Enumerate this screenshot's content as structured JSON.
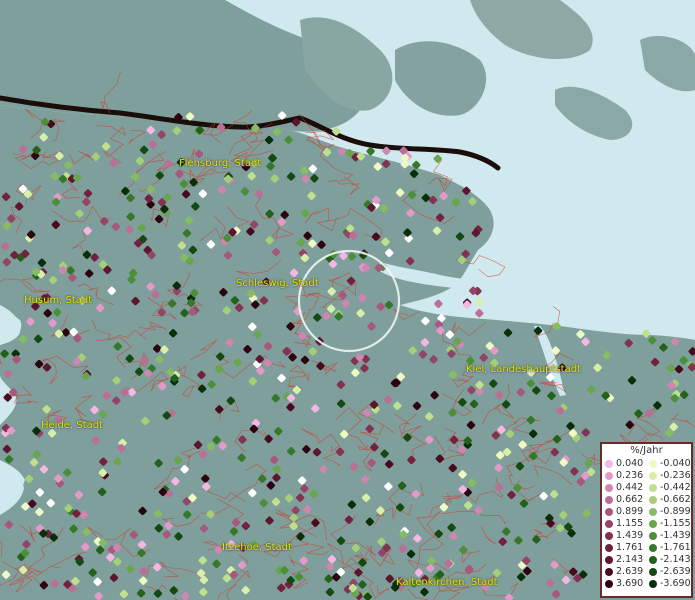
{
  "cities": [
    {
      "name": "Flensburg, Stadt"
    },
    {
      "name": "Schleswig, Stadt"
    },
    {
      "name": "Husum, Stadt"
    },
    {
      "name": "Kiel, Landeshauptstadt"
    },
    {
      "name": "Heide, Stadt"
    },
    {
      "name": "Itzehoe, Stadt"
    },
    {
      "name": "Kaltenkirchen, Stadt"
    }
  ],
  "legend": {
    "title": "%/Jahr",
    "positive": [
      {
        "label": "0.040",
        "color": "#f4b7e4"
      },
      {
        "label": "0.236",
        "color": "#e39acb"
      },
      {
        "label": "0.442",
        "color": "#cf86b0"
      },
      {
        "label": "0.662",
        "color": "#bb6f96"
      },
      {
        "label": "0.899",
        "color": "#a7587c"
      },
      {
        "label": "1.155",
        "color": "#944466"
      },
      {
        "label": "1.439",
        "color": "#833251"
      },
      {
        "label": "1.761",
        "color": "#72223f"
      },
      {
        "label": "2.143",
        "color": "#5e152e"
      },
      {
        "label": "2.639",
        "color": "#470b1e"
      },
      {
        "label": "3.690",
        "color": "#2c0410"
      }
    ],
    "negative": [
      {
        "label": "-0.040",
        "color": "#eef9c4"
      },
      {
        "label": "-0.236",
        "color": "#d8efaa"
      },
      {
        "label": "-0.442",
        "color": "#bfe08f"
      },
      {
        "label": "-0.662",
        "color": "#a4cf78"
      },
      {
        "label": "-0.899",
        "color": "#86bc62"
      },
      {
        "label": "-1.155",
        "color": "#67a64d"
      },
      {
        "label": "-1.439",
        "color": "#4c8f3a"
      },
      {
        "label": "-1.761",
        "color": "#36782a"
      },
      {
        "label": "-2.143",
        "color": "#23611d"
      },
      {
        "label": "-2.639",
        "color": "#144a12"
      },
      {
        "label": "-3.690",
        "color": "#07300a"
      }
    ]
  },
  "colors": {
    "sea": "#cfe9ef",
    "land": "#7e9f9b",
    "border": "#1a0e0a",
    "district_lines": "#d43a2a",
    "label_text": "#e7e300",
    "legend_frame": "#6b2a2a"
  }
}
